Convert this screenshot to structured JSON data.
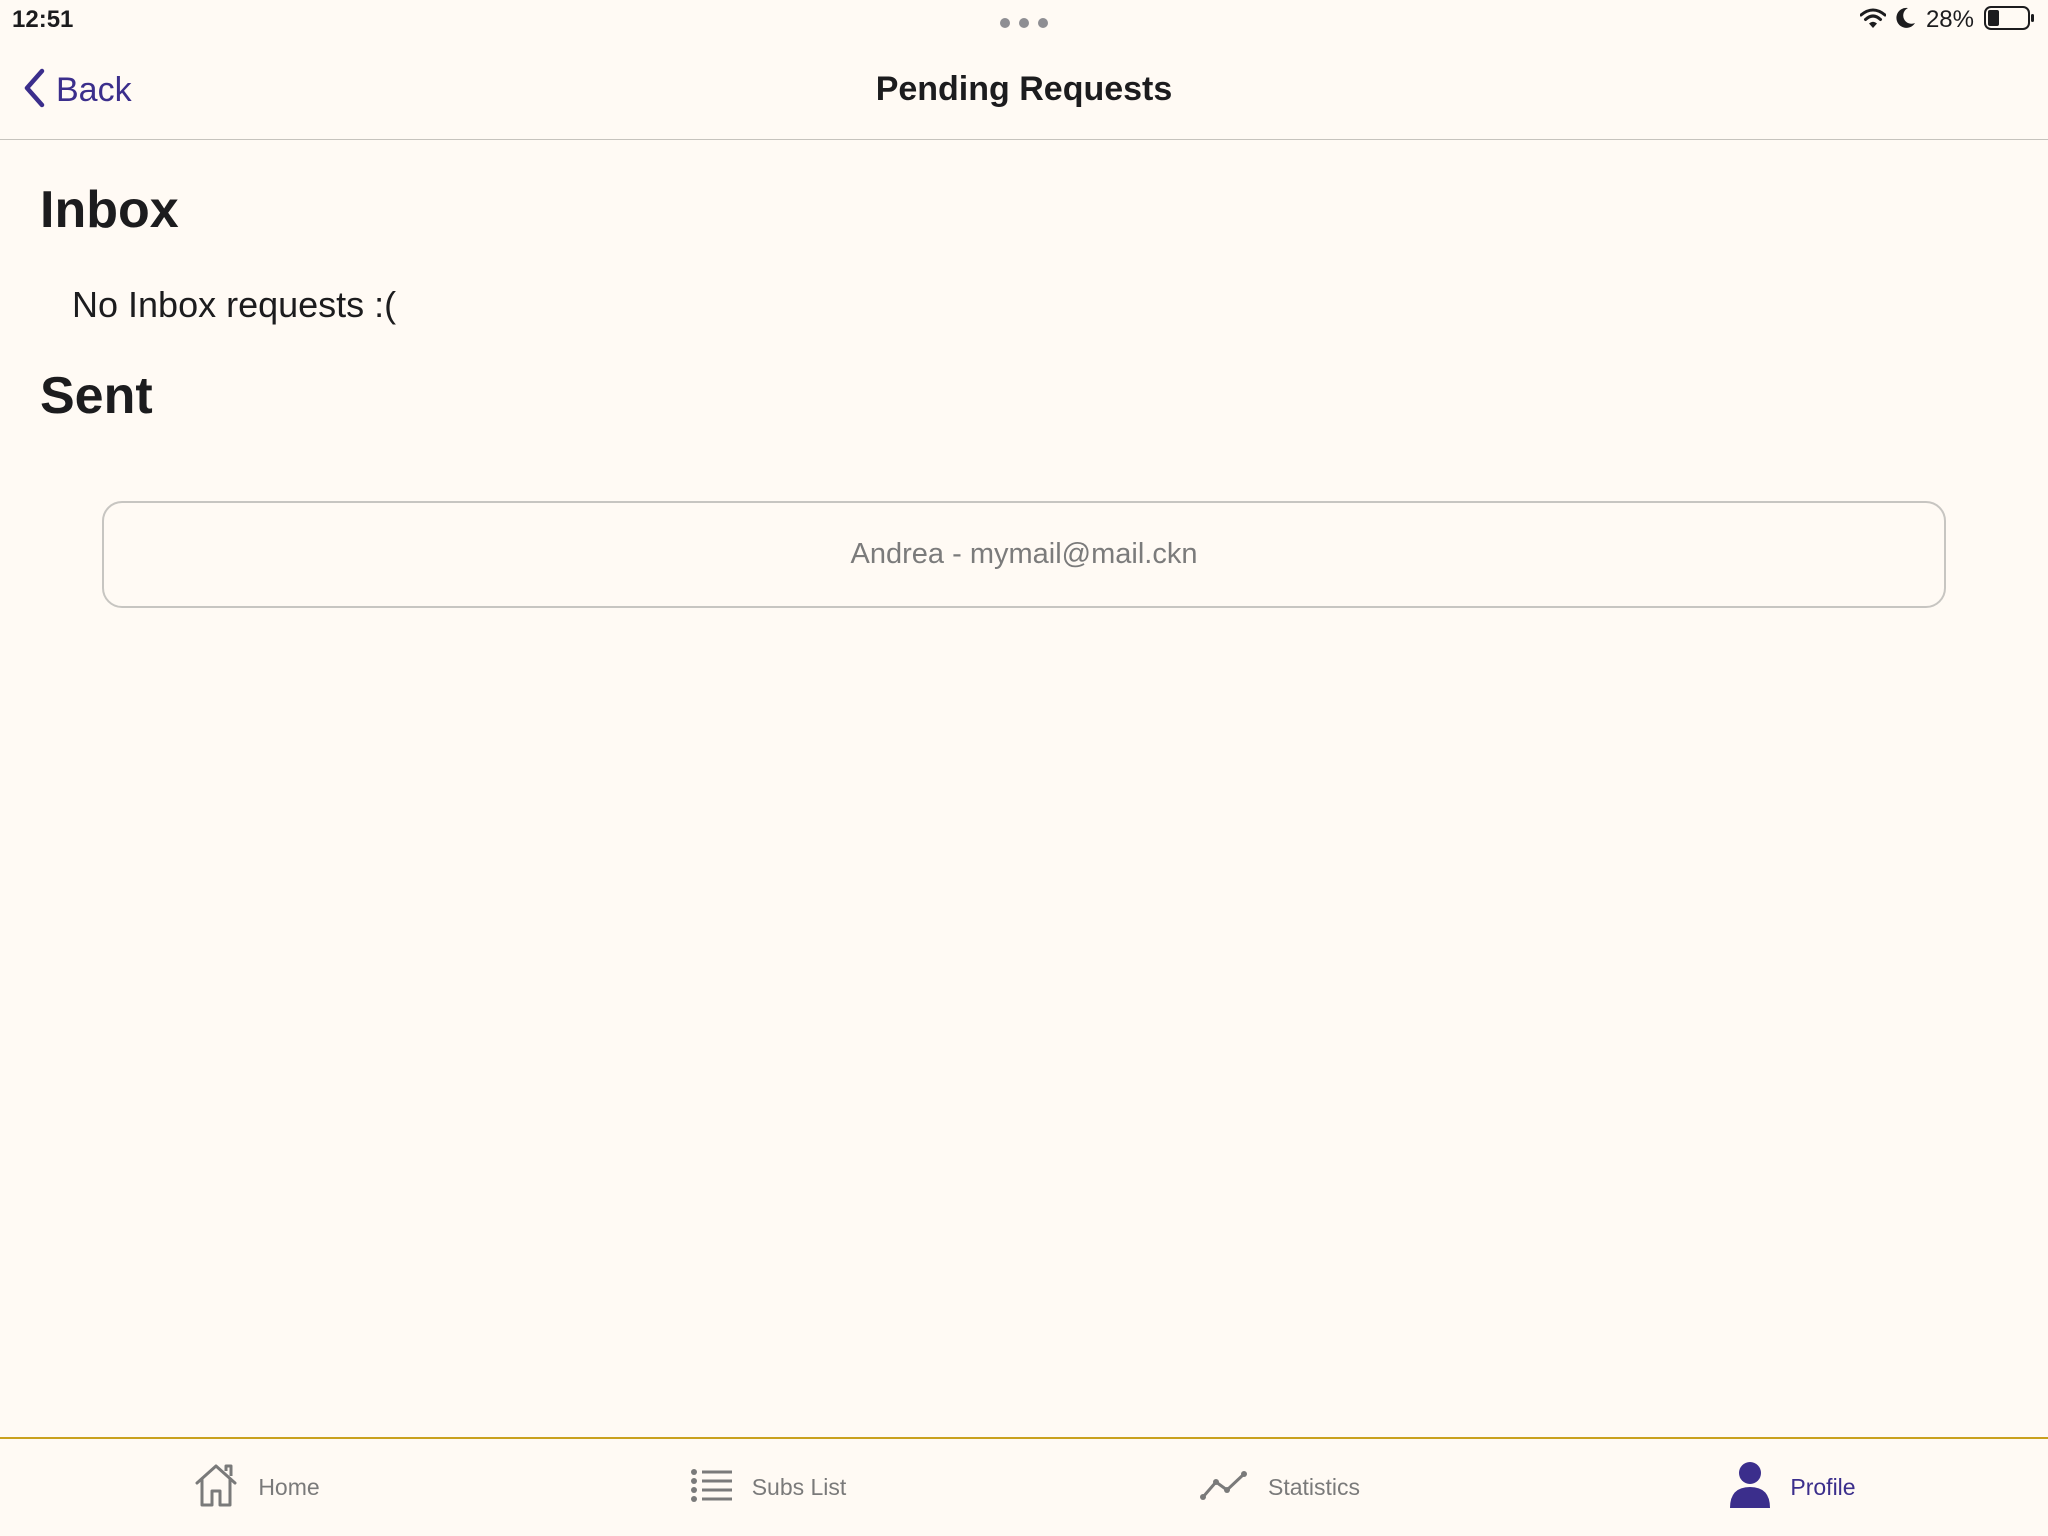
{
  "status_bar": {
    "time": "12:51",
    "battery_percent": "28%"
  },
  "nav": {
    "back_label": "Back",
    "title": "Pending Requests"
  },
  "inbox": {
    "title": "Inbox",
    "empty_message": "No Inbox requests :("
  },
  "sent": {
    "title": "Sent",
    "requests": [
      {
        "label": "Andrea - mymail@mail.ckn"
      }
    ]
  },
  "tabs": [
    {
      "label": "Home",
      "icon": "home-icon",
      "active": false
    },
    {
      "label": "Subs List",
      "icon": "list-icon",
      "active": false
    },
    {
      "label": "Statistics",
      "icon": "chart-line-icon",
      "active": false
    },
    {
      "label": "Profile",
      "icon": "person-icon",
      "active": true
    }
  ],
  "colors": {
    "accent": "#3b2e8c",
    "background": "#fffaf4",
    "tab_bar_border": "#c9a11e",
    "inactive": "#7a7a7a"
  }
}
